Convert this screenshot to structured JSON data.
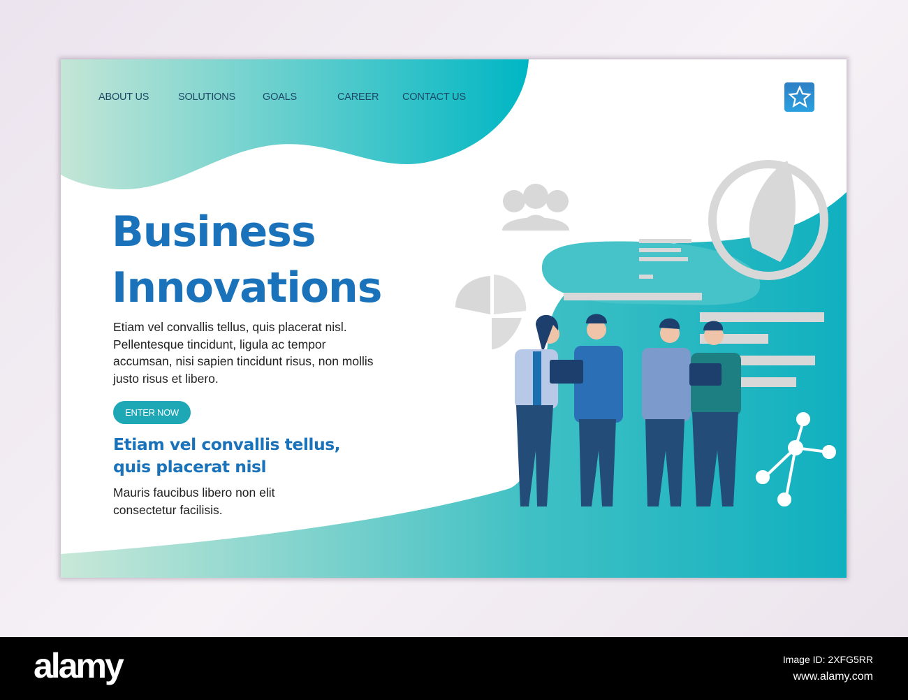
{
  "nav": {
    "items": [
      "ABOUT US",
      "SOLUTIONS",
      "GOALS",
      "CAREER",
      "CONTACT US"
    ]
  },
  "logo_icon": "star-icon",
  "hero": {
    "title_line1": "Business",
    "title_line2": "Innovations",
    "paragraph": "Etiam vel convallis tellus, quis placerat nisl. Pellentesque tincidunt, ligula ac tempor accumsan, nisi sapien tincidunt risus, non mollis justo risus et libero.",
    "button": "ENTER NOW",
    "subheading": "Etiam vel convallis tellus, quis placerat nisl",
    "body": "Mauris faucibus libero non elit consectetur facilisis."
  },
  "colors": {
    "accent": "#1a73ba",
    "teal": "#1ea8b6",
    "nav_text": "#1c4866"
  },
  "footer": {
    "brand": "alamy",
    "image_id": "Image ID: 2XFG5RR",
    "site": "www.alamy.com"
  }
}
